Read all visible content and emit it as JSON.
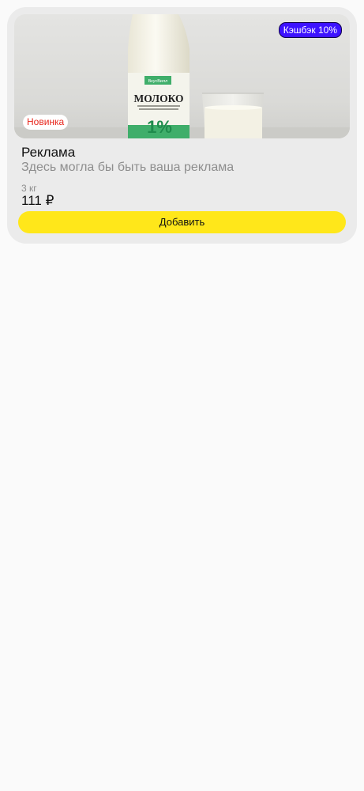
{
  "card": {
    "cashback_badge": "Кэшбэк 10%",
    "new_badge": "Новинка",
    "title": "Реклама",
    "subtitle": "Здесь могла бы быть ваша реклама",
    "weight": "3 кг",
    "price": "111 ₽",
    "add_button_label": "Добавить"
  },
  "product_image": {
    "brand_label": "ВкусВилл",
    "product_name": "МОЛОКО",
    "fat_percent": "1%"
  },
  "colors": {
    "cashback_bg": "#3d12ff",
    "new_badge_text": "#e8261c",
    "button_bg": "#ffe71a",
    "label_green": "#2a9d5c"
  }
}
